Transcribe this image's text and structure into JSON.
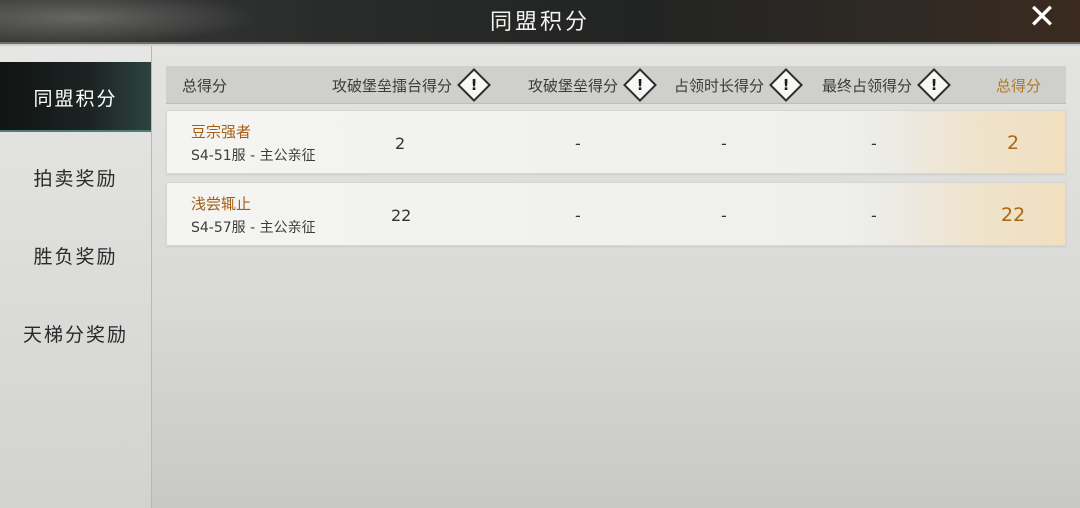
{
  "window": {
    "title": "同盟积分",
    "close_icon": "close-icon"
  },
  "sidebar": {
    "items": [
      {
        "label": "同盟积分",
        "active": true
      },
      {
        "label": "拍卖奖励",
        "active": false
      },
      {
        "label": "胜负奖励",
        "active": false
      },
      {
        "label": "天梯分奖励",
        "active": false
      }
    ]
  },
  "table": {
    "headers": {
      "total_label": "总得分",
      "attack_arena": "攻破堡垒擂台得分",
      "attack_fort": "攻破堡垒得分",
      "occupy_time": "占领时长得分",
      "final_occupy": "最终占领得分",
      "total": "总得分",
      "info_icon": "!"
    },
    "rows": [
      {
        "name": "豆宗强者",
        "server": "S4-51服 - 主公亲征",
        "attack_arena": "2",
        "attack_fort": "-",
        "occupy_time": "-",
        "final_occupy": "-",
        "total": "2"
      },
      {
        "name": "浅尝辄止",
        "server": "S4-57服 - 主公亲征",
        "attack_arena": "22",
        "attack_fort": "-",
        "occupy_time": "-",
        "final_occupy": "-",
        "total": "22"
      }
    ]
  },
  "colors": {
    "accent_gold": "#a86812",
    "sidebar_active": "#1c2423"
  }
}
